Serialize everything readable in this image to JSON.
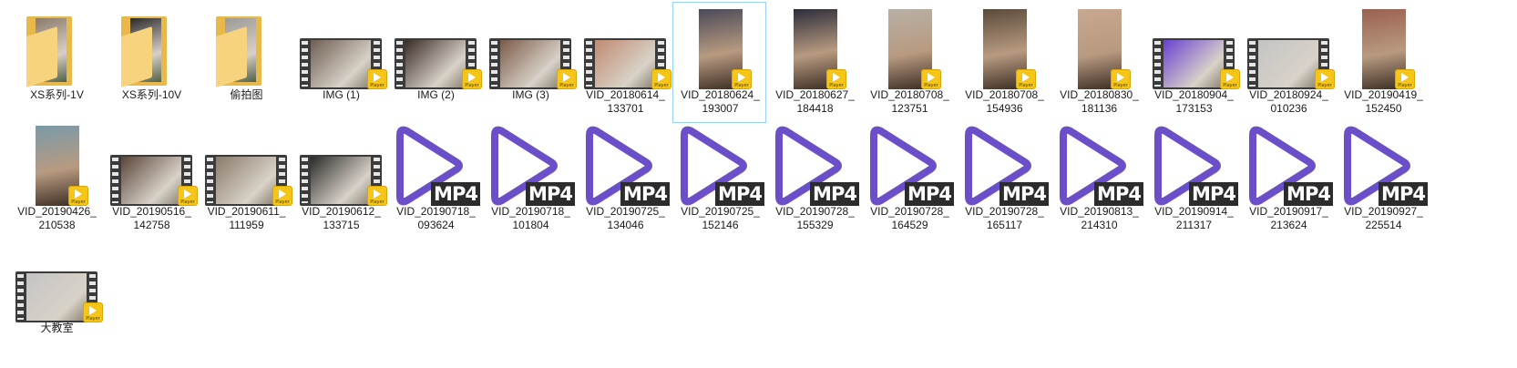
{
  "items": [
    {
      "label": "XS系列-1V",
      "kind": "folder",
      "icon": "folder-icon"
    },
    {
      "label": "XS系列-10V",
      "kind": "folder",
      "icon": "folder-icon"
    },
    {
      "label": "偷拍图",
      "kind": "folder",
      "icon": "folder-icon"
    },
    {
      "label": "IMG (1)",
      "kind": "video",
      "icon": "video-thumbnail-icon"
    },
    {
      "label": "IMG (2)",
      "kind": "video",
      "icon": "video-thumbnail-icon"
    },
    {
      "label": "IMG (3)",
      "kind": "video",
      "icon": "video-thumbnail-icon"
    },
    {
      "label": "VID_20180614_\n133701",
      "kind": "video",
      "icon": "video-thumbnail-icon"
    },
    {
      "label": "VID_20180624_\n193007",
      "kind": "portrait",
      "icon": "video-thumbnail-icon",
      "selected": true
    },
    {
      "label": "VID_20180627_\n184418",
      "kind": "portrait",
      "icon": "video-thumbnail-icon"
    },
    {
      "label": "VID_20180708_\n123751",
      "kind": "portrait",
      "icon": "video-thumbnail-icon"
    },
    {
      "label": "VID_20180708_\n154936",
      "kind": "portrait",
      "icon": "video-thumbnail-icon"
    },
    {
      "label": "VID_20180830_\n181136",
      "kind": "portrait",
      "icon": "video-thumbnail-icon"
    },
    {
      "label": "VID_20180904_\n173153",
      "kind": "video",
      "icon": "video-thumbnail-icon"
    },
    {
      "label": "VID_20180924_\n010236",
      "kind": "video",
      "icon": "video-thumbnail-icon"
    },
    {
      "label": "VID_20190419_\n152450",
      "kind": "portrait",
      "icon": "video-thumbnail-icon"
    },
    {
      "label": "VID_20190426_\n210538",
      "kind": "portrait",
      "icon": "video-thumbnail-icon"
    },
    {
      "label": "VID_20190516_\n142758",
      "kind": "video",
      "icon": "video-thumbnail-icon"
    },
    {
      "label": "VID_20190611_\n111959",
      "kind": "video",
      "icon": "video-thumbnail-icon"
    },
    {
      "label": "VID_20190612_\n133715",
      "kind": "video",
      "icon": "video-thumbnail-icon"
    },
    {
      "label": "VID_20190718_\n093624",
      "kind": "mp4",
      "icon": "mp4-play-icon"
    },
    {
      "label": "VID_20190718_\n101804",
      "kind": "mp4",
      "icon": "mp4-play-icon"
    },
    {
      "label": "VID_20190725_\n134046",
      "kind": "mp4",
      "icon": "mp4-play-icon"
    },
    {
      "label": "VID_20190725_\n152146",
      "kind": "mp4",
      "icon": "mp4-play-icon"
    },
    {
      "label": "VID_20190728_\n155329",
      "kind": "mp4",
      "icon": "mp4-play-icon"
    },
    {
      "label": "VID_20190728_\n164529",
      "kind": "mp4",
      "icon": "mp4-play-icon"
    },
    {
      "label": "VID_20190728_\n165117",
      "kind": "mp4",
      "icon": "mp4-play-icon"
    },
    {
      "label": "VID_20190813_\n214310",
      "kind": "mp4",
      "icon": "mp4-play-icon"
    },
    {
      "label": "VID_20190914_\n211317",
      "kind": "mp4",
      "icon": "mp4-play-icon"
    },
    {
      "label": "VID_20190917_\n213624",
      "kind": "mp4",
      "icon": "mp4-play-icon"
    },
    {
      "label": "VID_20190927_\n225514",
      "kind": "mp4",
      "icon": "mp4-play-icon"
    },
    {
      "label": "大教室",
      "kind": "video",
      "icon": "video-thumbnail-icon"
    }
  ],
  "badge_text": "Player",
  "mp4_tag": "MP4",
  "colors": {
    "mp4_triangle": "#6b4fc9",
    "mp4_tag_bg": "#2c2c2c",
    "badge": "#f5c518",
    "folder": "#f6d37c",
    "selection_border": "#99d1ff"
  }
}
